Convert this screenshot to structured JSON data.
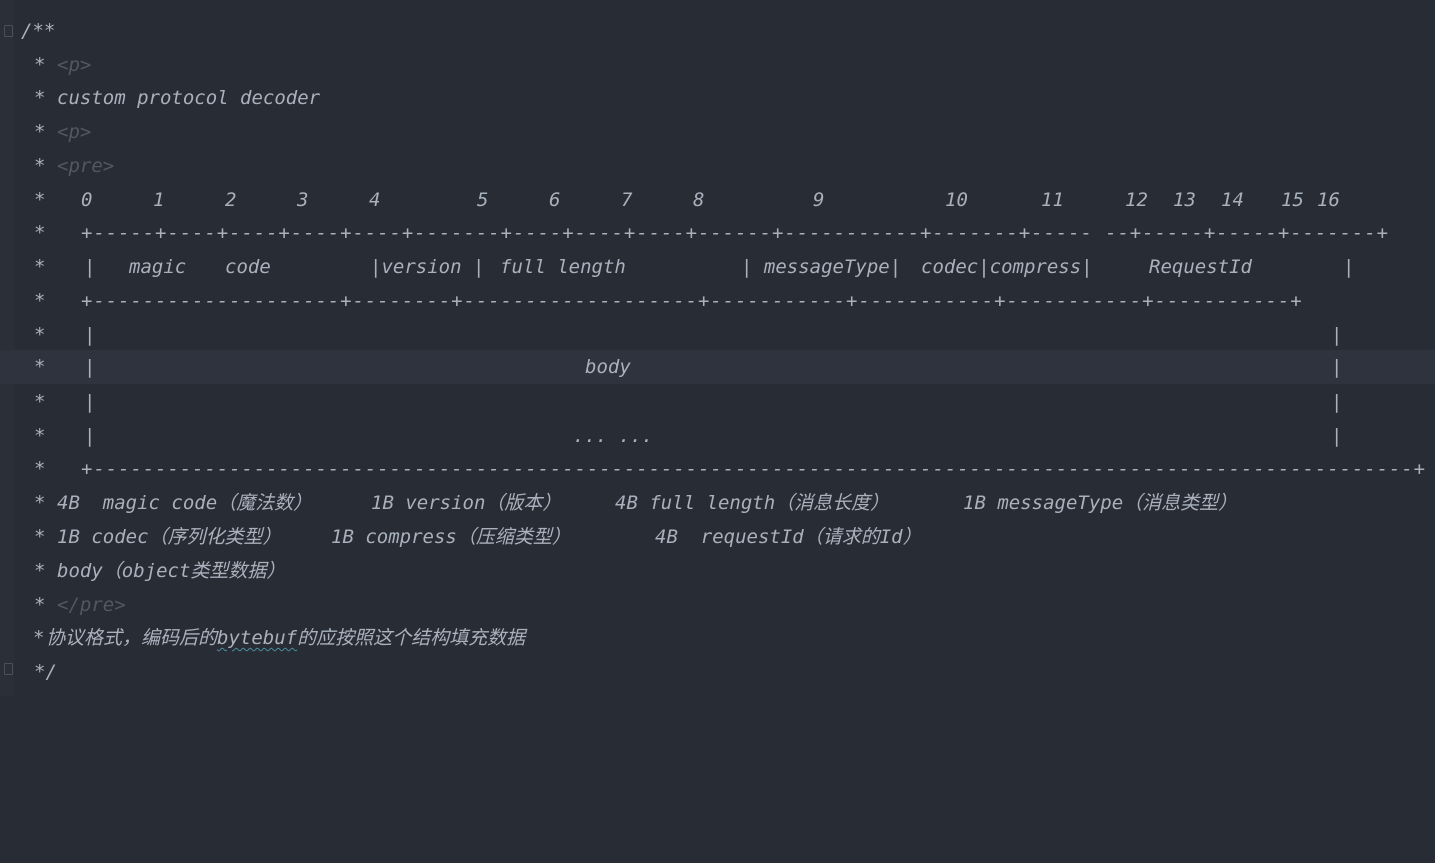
{
  "editor": {
    "theme_colors": {
      "background": "#282c34",
      "current_line": "#2f333d",
      "comment_text": "#a9b1bd",
      "html_tag": "#515862",
      "spell_check": "#4d8ea0"
    },
    "doc": {
      "open": "/**",
      "star": "*",
      "p_tag": "<p>",
      "description": "custom protocol decoder",
      "pre_open": "<pre>",
      "pre_close": "</pre>",
      "close": "*/"
    },
    "diagram": {
      "offsets": {
        "o0": "0",
        "o1": "1",
        "o2": "2",
        "o3": "3",
        "o4": "4",
        "o5": "5",
        "o6": "6",
        "o7": "7",
        "o8": "8",
        "o9": "9",
        "o10": "10",
        "o11": "11",
        "o12": "12",
        "o13": "13",
        "o14": "14",
        "o15": "15",
        "o16": "16"
      },
      "top_border": "+-----+----+----+----+----+-------+----+----+----+------+-----------+-------+----- --+-----+-----+-------+",
      "header_pipe": "|",
      "header_magic": "magic",
      "header_code": "code",
      "header_version": "|version |",
      "header_full_length": "full length",
      "header_message_type": "| messageType|",
      "header_codec": "codec|compress|",
      "header_request_id": "RequestId",
      "header_end": "|",
      "mid_border": "+--------------------+--------+-------------------+-----------+-----------+-----------+-----------+",
      "pipe": "|",
      "body_label": "body",
      "ellipsis": "... ...",
      "bottom_border": "+-----------------------------------------------------------------------------------------------------------+"
    },
    "legend": {
      "l1_magic": "4B  magic code（魔法数）",
      "l1_version": "1B version（版本）",
      "l1_full_length": "4B full length（消息长度）",
      "l1_message_type": "1B messageType（消息类型）",
      "l2_codec": "1B codec（序列化类型）",
      "l2_compress": "1B compress（压缩类型）",
      "l2_request_id": "4B  requestId（请求的Id）",
      "l3_body": "body（object类型数据）"
    },
    "footer_note": {
      "prefix": "协议格式，编码后的",
      "keyword": "bytebuf",
      "suffix": "的应按照这个结构填充数据"
    }
  }
}
